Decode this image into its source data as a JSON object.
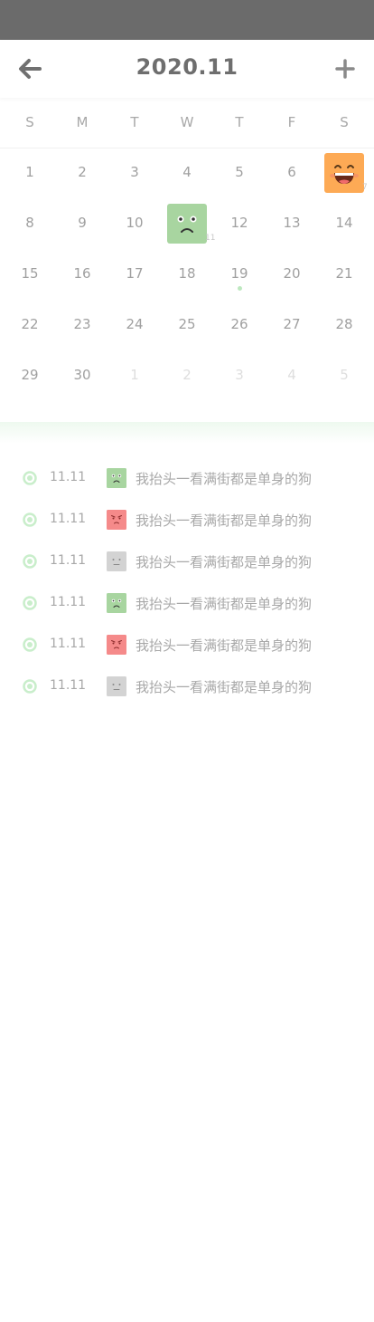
{
  "header": {
    "title": "2020.11",
    "back_icon": "arrow-left-icon",
    "add_icon": "plus-icon"
  },
  "weekdays": [
    "S",
    "M",
    "T",
    "W",
    "T",
    "F",
    "S"
  ],
  "calendar": {
    "weeks": [
      [
        {
          "d": "1"
        },
        {
          "d": "2"
        },
        {
          "d": "3"
        },
        {
          "d": "4"
        },
        {
          "d": "5"
        },
        {
          "d": "6"
        },
        {
          "d": "7",
          "mood": "laugh",
          "color": "#fdaa55"
        }
      ],
      [
        {
          "d": "8"
        },
        {
          "d": "9"
        },
        {
          "d": "10"
        },
        {
          "d": "11",
          "mood": "sad",
          "color": "#a8d5a0"
        },
        {
          "d": "12"
        },
        {
          "d": "13"
        },
        {
          "d": "14"
        }
      ],
      [
        {
          "d": "15"
        },
        {
          "d": "16"
        },
        {
          "d": "17"
        },
        {
          "d": "18"
        },
        {
          "d": "19",
          "dot": true
        },
        {
          "d": "20"
        },
        {
          "d": "21"
        }
      ],
      [
        {
          "d": "22"
        },
        {
          "d": "23"
        },
        {
          "d": "24"
        },
        {
          "d": "25"
        },
        {
          "d": "26"
        },
        {
          "d": "27"
        },
        {
          "d": "28"
        }
      ],
      [
        {
          "d": "29"
        },
        {
          "d": "30"
        },
        {
          "d": "1",
          "other": true
        },
        {
          "d": "2",
          "other": true
        },
        {
          "d": "3",
          "other": true
        },
        {
          "d": "4",
          "other": true
        },
        {
          "d": "5",
          "other": true
        }
      ]
    ]
  },
  "records": [
    {
      "date": "11.11",
      "mood": "sad",
      "color": "#a8d5a0",
      "text": "我抬头一看满街都是单身的狗"
    },
    {
      "date": "11.11",
      "mood": "angry",
      "color": "#f58a8a",
      "text": "我抬头一看满街都是单身的狗"
    },
    {
      "date": "11.11",
      "mood": "neutral",
      "color": "#d3d3d3",
      "text": "我抬头一看满街都是单身的狗"
    },
    {
      "date": "11.11",
      "mood": "sad",
      "color": "#a8d5a0",
      "text": "我抬头一看满街都是单身的狗"
    },
    {
      "date": "11.11",
      "mood": "angry",
      "color": "#f58a8a",
      "text": "我抬头一看满街都是单身的狗"
    },
    {
      "date": "11.11",
      "mood": "neutral",
      "color": "#d3d3d3",
      "text": "我抬头一看满街都是单身的狗"
    }
  ],
  "colors": {
    "accent_green": "#bde8bf",
    "ring_green": "#c9eecb",
    "status_bar": "#6b6b6b"
  }
}
